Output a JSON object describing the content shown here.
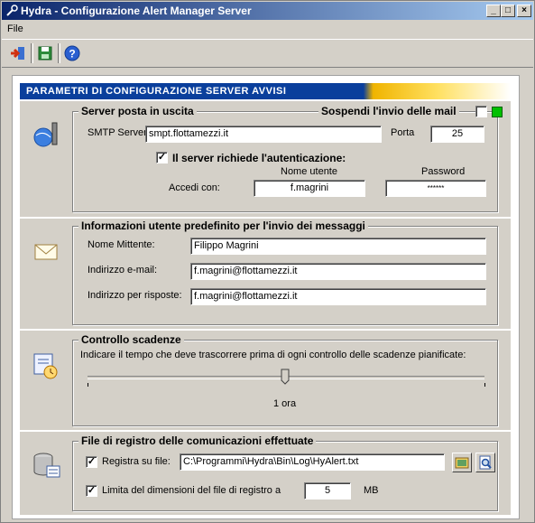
{
  "window": {
    "title": "Hydra - Configurazione Alert Manager Server"
  },
  "menu": {
    "file": "File"
  },
  "toolbar": {
    "exit": "exit-icon",
    "save": "save-icon",
    "help": "help-icon"
  },
  "banner": {
    "text": "PARAMETRI DI CONFIGURAZIONE SERVER AVVISI"
  },
  "smtp": {
    "group_title": "Server posta in uscita",
    "suspend_label": "Sospendi l'invio delle mail",
    "server_label": "SMTP Server",
    "server_value": "smpt.flottamezzi.it",
    "port_label": "Porta",
    "port_value": "25",
    "auth_label": "Il server richiede l'autenticazione:",
    "user_header": "Nome utente",
    "password_header": "Password",
    "login_label": "Accedi con:",
    "user_value": "f.magrini",
    "password_value": "******"
  },
  "user_info": {
    "group_title": "Informazioni utente predefinito per l'invio dei messaggi",
    "sender_label": "Nome Mittente:",
    "sender_value": "Filippo Magrini",
    "email_label": "Indirizzo e-mail:",
    "email_value": "f.magrini@flottamezzi.it",
    "reply_label": "Indirizzo per risposte:",
    "reply_value": "f.magrini@flottamezzi.it"
  },
  "deadline": {
    "group_title": "Controllo scadenze",
    "description": "Indicare il tempo che deve trascorrere prima di ogni controllo delle scadenze pianificate:",
    "slider_value_label": "1 ora"
  },
  "log": {
    "group_title": "File di registro delle comunicazioni effettuate",
    "register_label": "Registra su file:",
    "register_path": "C:\\Programmi\\Hydra\\Bin\\Log\\HyAlert.txt",
    "limit_label": "Limita del dimensioni del file di registro a",
    "limit_value": "5",
    "limit_unit": "MB"
  }
}
